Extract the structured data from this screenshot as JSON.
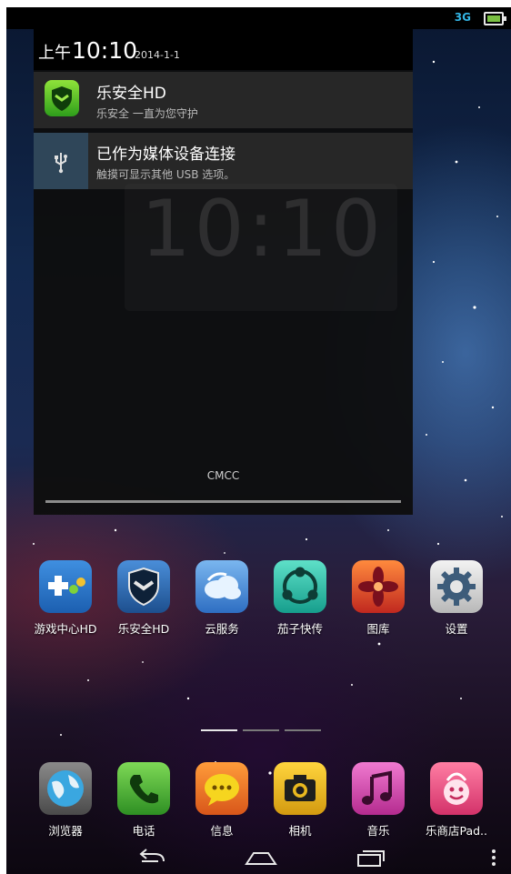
{
  "status_bar": {
    "network": "3G",
    "battery_icon": "battery-charging-icon"
  },
  "shade": {
    "time_ampm": "上午",
    "time": "10:10",
    "date": "2014-1-1",
    "notifications": [
      {
        "title": "乐安全HD",
        "subtitle": "乐安全 一直为您守护",
        "icon": "shield-icon"
      },
      {
        "title": "已作为媒体设备连接",
        "subtitle": "触摸可显示其他 USB 选项。",
        "icon": "usb-icon"
      }
    ],
    "carrier": "CMCC"
  },
  "home": {
    "row1": [
      {
        "label": "游戏中心HD",
        "icon": "gamepad-icon"
      },
      {
        "label": "乐安全HD",
        "icon": "shield-icon"
      },
      {
        "label": "云服务",
        "icon": "cloud-icon"
      },
      {
        "label": "茄子快传",
        "icon": "share-icon"
      },
      {
        "label": "图库",
        "icon": "gallery-flower-icon"
      },
      {
        "label": "设置",
        "icon": "gear-icon"
      }
    ],
    "page_indicator": {
      "pages": 3,
      "current": 1
    }
  },
  "dock": [
    {
      "label": "浏览器",
      "icon": "globe-icon"
    },
    {
      "label": "电话",
      "icon": "phone-icon"
    },
    {
      "label": "信息",
      "icon": "message-icon"
    },
    {
      "label": "相机",
      "icon": "camera-icon"
    },
    {
      "label": "音乐",
      "icon": "music-note-icon"
    },
    {
      "label": "乐商店Pad..",
      "icon": "store-bag-icon"
    }
  ],
  "navbar": [
    "back-icon",
    "home-icon",
    "recent-apps-icon",
    "menu-overflow-icon"
  ],
  "colors": {
    "accent": "#33b5e5",
    "shade_bg": "#0e0e0e",
    "notif_bg": "#272727"
  }
}
